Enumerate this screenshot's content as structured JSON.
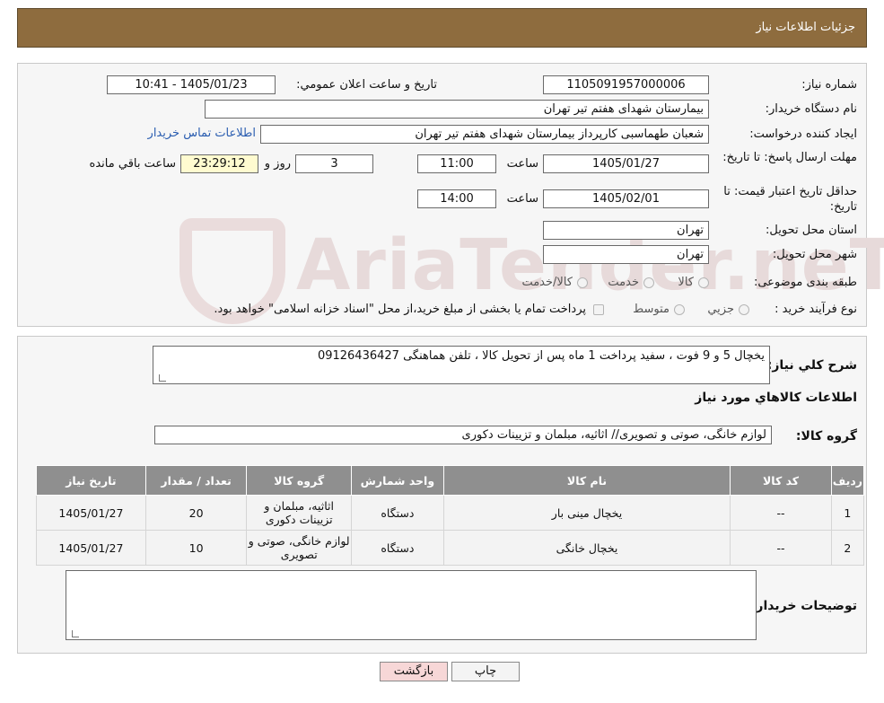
{
  "header": {
    "title": "جزئیات اطلاعات نیاز"
  },
  "info": {
    "need_number_label": "شماره نیاز:",
    "need_number": "1105091957000006",
    "announce_label": "تاریخ و ساعت اعلان عمومي:",
    "announce_value": "1405/01/23 - 10:41",
    "buyer_label": "نام دستگاه خریدار:",
    "buyer_value": "بیمارستان شهدای هفتم تیر تهران",
    "creator_label": "ایجاد کننده درخواست:",
    "creator_value": "شعبان طهماسبی کارپرداز بیمارستان شهدای هفتم تیر تهران",
    "contact_link": "اطلاعات تماس خریدار",
    "deadline_label": "مهلت ارسال پاسخ: تا تاریخ:",
    "deadline_date": "1405/01/27",
    "time_label": "ساعت",
    "deadline_time": "11:00",
    "days_value": "3",
    "days_label": "روز و",
    "remaining_time": "23:29:12",
    "remaining_label": "ساعت باقي مانده",
    "validity_label": "حداقل تاریخ اعتبار قیمت: تا تاریخ:",
    "validity_date": "1405/02/01",
    "validity_time": "14:00",
    "province_label": "استان محل تحویل:",
    "province_value": "تهران",
    "city_label": "شهر محل تحویل:",
    "city_value": "تهران",
    "category_label": "طبقه بندی موضوعی:",
    "category_options": [
      "کالا",
      "خدمت",
      "کالا/خدمت"
    ],
    "process_label": "نوع فرآیند خرید :",
    "process_options": [
      "جزیي",
      "متوسط"
    ],
    "process_note": "پرداخت تمام یا بخشی از مبلغ خرید،از محل \"اسناد خزانه اسلامی\" خواهد بود."
  },
  "description": {
    "label": "شرح کلي نياز:",
    "value": "یخچال 5 و 9 فوت ، سفید پرداخت 1 ماه پس از تحویل کالا ، تلفن هماهنگی 09126436427"
  },
  "goods": {
    "section_title": "اطلاعات کالاهاي مورد نياز",
    "group_label": "گروه کالا:",
    "group_value": "لوازم خانگی، صوتی و تصویری// اثاثیه، مبلمان و تزیینات دکوری",
    "columns": [
      "ردیف",
      "کد کالا",
      "نام کالا",
      "واحد شمارش",
      "گروه کالا",
      "تعداد / مقدار",
      "تاریخ نیاز"
    ],
    "rows": [
      {
        "row": "1",
        "code": "--",
        "name": "یخچال مینی بار",
        "unit": "دستگاه",
        "group": "اثاثیه، مبلمان و تزیینات دکوری",
        "qty": "20",
        "date": "1405/01/27"
      },
      {
        "row": "2",
        "code": "--",
        "name": "یخچال خانگی",
        "unit": "دستگاه",
        "group": "لوازم خانگی، صوتی و تصویری",
        "qty": "10",
        "date": "1405/01/27"
      }
    ]
  },
  "buyer_notes": {
    "label": "توضیحات خریدار:",
    "value": ""
  },
  "buttons": {
    "print": "چاپ",
    "back": "بازگشت"
  },
  "watermark": {
    "text": "AriaTender.neT"
  },
  "colors": {
    "header_bg": "#8e6c3e",
    "table_header_bg": "#8f8f8f",
    "link": "#2a5db0",
    "back_button_bg": "#f7d7d7"
  }
}
